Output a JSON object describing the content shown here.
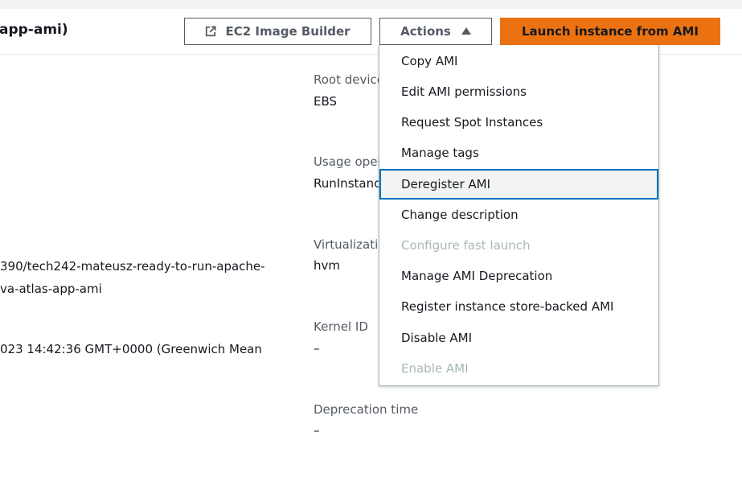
{
  "header": {
    "title": "app-ami)",
    "image_builder_label": "EC2 Image Builder",
    "actions_label": "Actions",
    "launch_label": "Launch instance from AMI"
  },
  "left_details": {
    "location_line1": "390/tech242-mateusz-ready-to-run-apache-",
    "location_line2": "va-atlas-app-ami",
    "creation_date": "023 14:42:36 GMT+0000 (Greenwich Mean"
  },
  "right_details": {
    "root_device_label": "Root device type",
    "root_device_value": "EBS",
    "usage_label": "Usage operation",
    "usage_value": "RunInstances",
    "virtualization_label": "Virtualization type",
    "virtualization_value": "hvm",
    "kernel_label": "Kernel ID",
    "kernel_value": "–",
    "deprecation_label": "Deprecation time",
    "deprecation_value": "–"
  },
  "actions_menu": {
    "items": [
      {
        "label": "Copy AMI",
        "disabled": false
      },
      {
        "label": "Edit AMI permissions",
        "disabled": false
      },
      {
        "label": "Request Spot Instances",
        "disabled": false
      },
      {
        "label": "Manage tags",
        "disabled": false
      },
      {
        "label": "Deregister AMI",
        "disabled": false,
        "highlighted": true
      },
      {
        "label": "Change description",
        "disabled": false
      },
      {
        "label": "Configure fast launch",
        "disabled": true
      },
      {
        "label": "Manage AMI Deprecation",
        "disabled": false
      },
      {
        "label": "Register instance store-backed AMI",
        "disabled": false
      },
      {
        "label": "Disable AMI",
        "disabled": false
      },
      {
        "label": "Enable AMI",
        "disabled": true
      }
    ]
  },
  "colors": {
    "primary": "#ec7211",
    "focus": "#0073bb",
    "disabled": "#aab7b8",
    "label": "#545b64",
    "text": "#16191f"
  },
  "icons": {
    "external_link": "external-link-icon",
    "caret": "caret-up-icon"
  }
}
